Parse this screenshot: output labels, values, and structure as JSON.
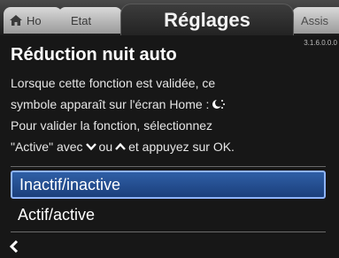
{
  "tabs": {
    "home_label": "Ho",
    "etat_label": "Etat",
    "active_label": "Réglages",
    "assist_label": "Assis"
  },
  "version": "3.1.6.0.0.0",
  "page": {
    "title": "Réduction nuit auto",
    "description": {
      "line1": "Lorsque cette fonction est validée, ce",
      "line2": "symbole apparaît sur l'écran Home :",
      "line3": "Pour valider la fonction, sélectionnez",
      "line4_prefix": "\"Active\" avec",
      "line4_middle": "ou",
      "line4_suffix": "et appuyez sur OK."
    }
  },
  "options": [
    {
      "label": "Inactif/inactive",
      "selected": true
    },
    {
      "label": "Actif/active",
      "selected": false
    }
  ],
  "icons": {
    "home": "home-icon",
    "moon": "night-setback-icon",
    "down": "chevron-down-icon",
    "up": "chevron-up-icon",
    "back": "chevron-left-icon"
  },
  "colors": {
    "selection": "#2f5fa6",
    "selection_border": "#8fb4ff",
    "background": "#171717",
    "text": "#ffffff"
  }
}
